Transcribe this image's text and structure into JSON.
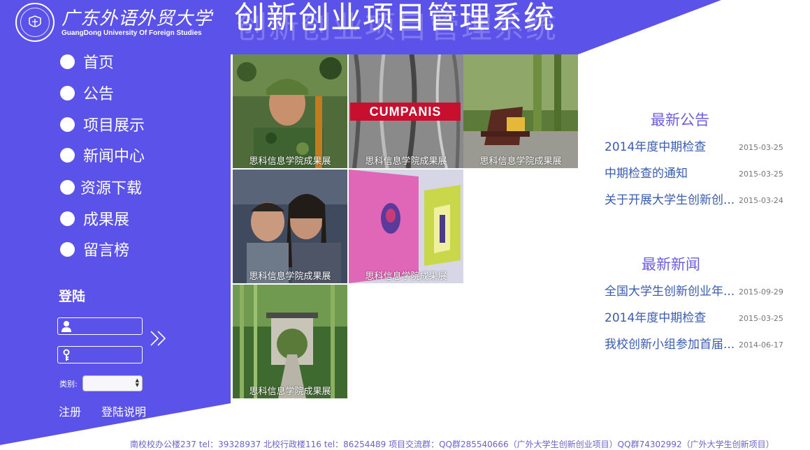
{
  "colors": {
    "primary": "#5b52ea",
    "link": "#3a5cb0",
    "section_title": "#6d5fe0"
  },
  "logo": {
    "name_cn": "广东外语外贸大学",
    "name_en": "GuangDong University Of Foreign Studies"
  },
  "header": {
    "title": "创新创业项目管理系统"
  },
  "nav": {
    "items": [
      {
        "label": "首页"
      },
      {
        "label": "公告"
      },
      {
        "label": "项目展示"
      },
      {
        "label": "新闻中心"
      },
      {
        "label": "资源下载"
      },
      {
        "label": "成果展"
      },
      {
        "label": "留言榜"
      }
    ]
  },
  "login": {
    "title": "登陆",
    "username_value": "",
    "password_value": "",
    "category_label": "类别:",
    "category_value": "",
    "register_label": "注册",
    "help_label": "登陆说明"
  },
  "gallery": {
    "sign_text": "CUMPANIS",
    "items": [
      {
        "caption": "思科信息学院成果展",
        "icon": "soldier-photo"
      },
      {
        "caption": "思科信息学院成果展",
        "icon": "tree-bark-photo"
      },
      {
        "caption": "思科信息学院成果展",
        "icon": "garden-chair-photo"
      },
      {
        "caption": "思科信息学院成果展",
        "icon": "audience-photo"
      },
      {
        "caption": "思科信息学院成果展",
        "icon": "art-exhibit-photo"
      },
      {
        "caption": "思科信息学院成果展",
        "icon": "bamboo-path-photo"
      }
    ]
  },
  "announcements": {
    "title": "最新公告",
    "items": [
      {
        "title": "2014年度中期检查",
        "date": "2015-03-25"
      },
      {
        "title": "中期检查的通知",
        "date": "2015-03-25"
      },
      {
        "title": "关于开展大学生创新创...",
        "date": "2015-03-24"
      }
    ]
  },
  "news": {
    "title": "最新新闻",
    "items": [
      {
        "title": "全国大学生创新创业年...",
        "date": "2015-09-29"
      },
      {
        "title": "2014年度中期检查",
        "date": "2015-03-25"
      },
      {
        "title": "我校创新小组参加首届...",
        "date": "2014-06-17"
      }
    ]
  },
  "footer": {
    "text": "南校校办公楼237 tel：39328937 北校行政楼116 tel：86254489 项目交流群：QQ群285540666（广外大学生创新创业项目）QQ群74302992（广外大学生创新项目）"
  }
}
